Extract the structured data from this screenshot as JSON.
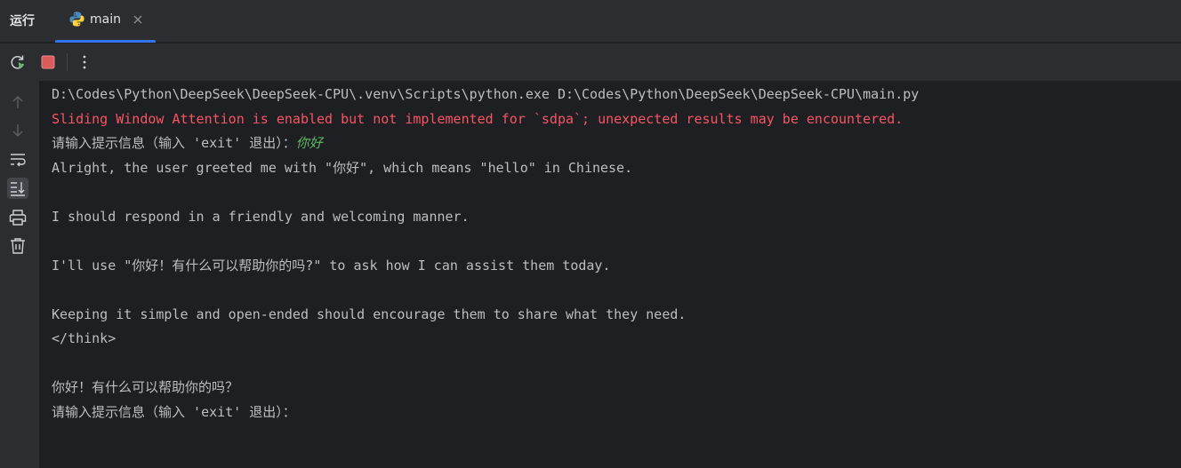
{
  "tabbar": {
    "run_title": "运行",
    "tab": {
      "label": "main",
      "icon": "python-icon"
    }
  },
  "toolbar": {
    "buttons": [
      "rerun-icon",
      "stop-icon",
      "more-icon"
    ]
  },
  "gutter": {
    "buttons": [
      "arrow-up-icon",
      "arrow-down-icon",
      "soft-wrap-icon",
      "scroll-to-end-icon",
      "print-icon",
      "trash-icon"
    ]
  },
  "console": {
    "command": "D:\\Codes\\Python\\DeepSeek\\DeepSeek-CPU\\.venv\\Scripts\\python.exe D:\\Codes\\Python\\DeepSeek\\DeepSeek-CPU\\main.py",
    "warning": "Sliding Window Attention is enabled but not implemented for `sdpa`; unexpected results may be encountered.",
    "prompt1": "请输入提示信息（输入 'exit' 退出）：",
    "user_input1": "你好",
    "out1": "Alright, the user greeted me with \"你好\", which means \"hello\" in Chinese.",
    "out2": "I should respond in a friendly and welcoming manner.",
    "out3": "I'll use \"你好！有什么可以帮助你的吗?\" to ask how I can assist them today.",
    "out4": "Keeping it simple and open-ended should encourage them to share what they need.",
    "out5": "</think>",
    "out6": "你好！有什么可以帮助你的吗？",
    "prompt2": "请输入提示信息（输入 'exit' 退出）："
  },
  "colors": {
    "accent": "#3574f0",
    "error": "#f75464",
    "user_input": "#5fb865",
    "stop": "#db5c5c"
  }
}
